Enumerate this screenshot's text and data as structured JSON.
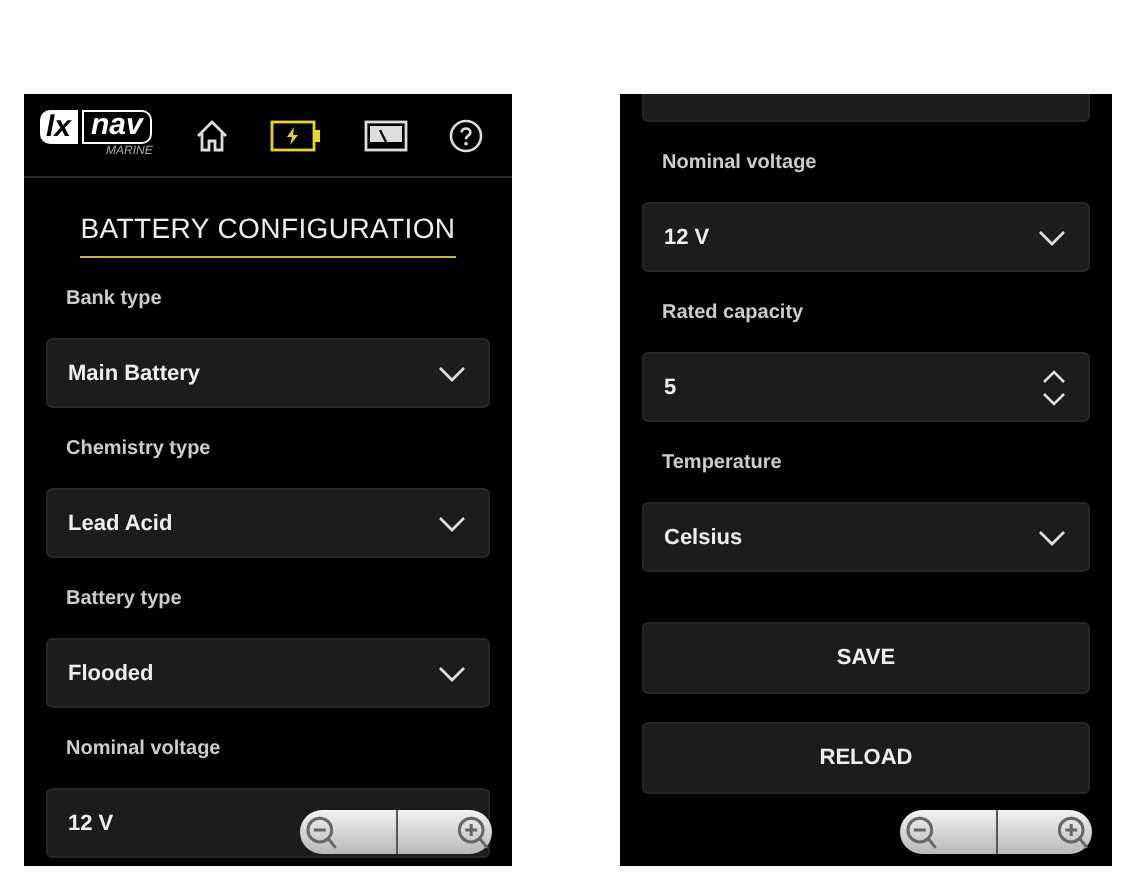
{
  "left_screen": {
    "header": {
      "logo": {
        "mark": "lx",
        "name": "nav",
        "sub": "MARINE"
      },
      "nav": [
        {
          "kind": "home",
          "selected": false
        },
        {
          "kind": "battery",
          "selected": true
        },
        {
          "kind": "gauge",
          "selected": false
        },
        {
          "kind": "help",
          "selected": false
        }
      ]
    },
    "title": "BATTERY CONFIGURATION",
    "fields": [
      {
        "kind": "dropdown",
        "label": "Bank type",
        "value": "Main Battery"
      },
      {
        "kind": "dropdown",
        "label": "Chemistry type",
        "value": "Lead Acid"
      },
      {
        "kind": "dropdown",
        "label": "Battery type",
        "value": "Flooded"
      },
      {
        "kind": "dropdown",
        "label": "Nominal voltage",
        "value": "12 V"
      }
    ]
  },
  "right_screen": {
    "fields": [
      {
        "kind": "dropdown"
      },
      {
        "kind": "dropdown",
        "label": "Nominal voltage",
        "value": "12 V"
      },
      {
        "kind": "number",
        "label": "Rated capacity",
        "value": "5"
      },
      {
        "kind": "dropdown",
        "label": "Temperature",
        "value": "Celsius"
      }
    ],
    "buttons": [
      "SAVE",
      "RELOAD"
    ]
  }
}
